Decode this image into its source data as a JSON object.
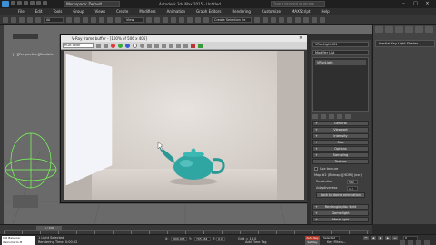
{
  "titlebar": {
    "workspace": "Workspace: Default",
    "doc_title": "Autodesk 3ds Max 2015 - Untitled",
    "search_placeholder": "Type a keyword or phrase"
  },
  "menu": [
    "File",
    "Edit",
    "Tools",
    "Group",
    "Views",
    "Create",
    "Modifiers",
    "Animation",
    "Graph Editors",
    "Rendering",
    "Customize",
    "MAXScript",
    "Help"
  ],
  "toolbar": {
    "selection_filter": "All",
    "ref_coord": "View",
    "named_sel": "Create Selection Se"
  },
  "viewport": {
    "label": "[+][Perspective][Realistic]"
  },
  "vfb": {
    "title": "V-Ray frame buffer - [100% of 506 x 406]",
    "channel": "RGB color",
    "close": "×"
  },
  "command_panel": {
    "object_name": "VRayLight001",
    "modifier_list": "Modifier List",
    "stack_item": "VRayLight",
    "rollouts_top": [
      "General",
      "Viewport",
      "Intensity",
      "Size",
      "Options",
      "Sampling",
      "Texture"
    ],
    "use_texture": "Use texture",
    "map_name": "Map #2 (Bitmap) [HDRI] (exr)",
    "resolution_label": "Resolution",
    "resolution_value": "512",
    "adaptiveness_label": "Adaptiveness",
    "adaptiveness_value": "1.0",
    "lock_button": "Lock to dome orientation",
    "rollouts_bottom": [
      "Rectangle/disc light",
      "Dome light",
      "Mesh light"
    ]
  },
  "right_panel": {
    "shader": "Inertial Key Light Shader"
  },
  "timeline": {
    "slider": "0 / 100",
    "ticks": 20
  },
  "statusbar": {
    "maxscript_line1": "CGI Balancer",
    "maxscript_line2": "Welcome to M",
    "status": "1 Light Selected",
    "render_time": "Rendering Time: 0:00:02",
    "x_label": "X:",
    "x_value": "-609.405",
    "y_label": "Y:",
    "y_value": "795.364",
    "z_label": "Z:",
    "z_value": "0.0",
    "grid": "Grid = 10.0",
    "add_time_tag": "Add Time Tag",
    "auto_key": "Auto Key",
    "auto_key_sel": "Selected",
    "set_key": "Set Key",
    "key_filters": "Key Filters...",
    "current_frame": "0"
  },
  "colors": {
    "teapot": "#2fa6a2",
    "auto_key": "#b33a2a",
    "window_panel": "#f2f4fa"
  }
}
